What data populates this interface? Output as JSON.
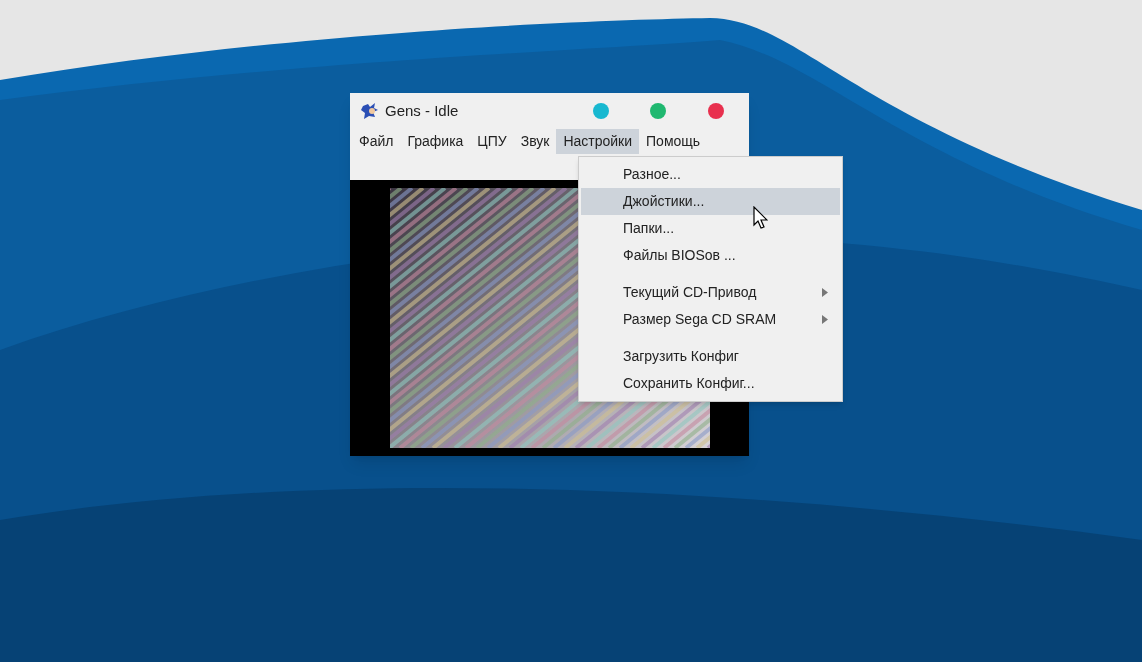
{
  "window": {
    "title": "Gens - Idle"
  },
  "menu_bar": [
    {
      "label": "Файл",
      "selected": false
    },
    {
      "label": "Графика",
      "selected": false
    },
    {
      "label": "ЦПУ",
      "selected": false
    },
    {
      "label": "Звук",
      "selected": false
    },
    {
      "label": "Настройки",
      "selected": true
    },
    {
      "label": "Помощь",
      "selected": false
    }
  ],
  "dropdown": [
    {
      "kind": "item",
      "label": "Разное...",
      "selected": false,
      "submenu": false
    },
    {
      "kind": "item",
      "label": "Джойстики...",
      "selected": true,
      "submenu": false
    },
    {
      "kind": "item",
      "label": "Папки...",
      "selected": false,
      "submenu": false
    },
    {
      "kind": "item",
      "label": "Файлы BIOSов ...",
      "selected": false,
      "submenu": false
    },
    {
      "kind": "separator"
    },
    {
      "kind": "item",
      "label": "Текущий CD-Привод",
      "selected": false,
      "submenu": true
    },
    {
      "kind": "item",
      "label": "Размер Sega CD SRAM",
      "selected": false,
      "submenu": true
    },
    {
      "kind": "separator"
    },
    {
      "kind": "item",
      "label": "Загрузить Конфиг",
      "selected": false,
      "submenu": false
    },
    {
      "kind": "item",
      "label": "Сохранить Конфиг...",
      "selected": false,
      "submenu": false
    }
  ]
}
